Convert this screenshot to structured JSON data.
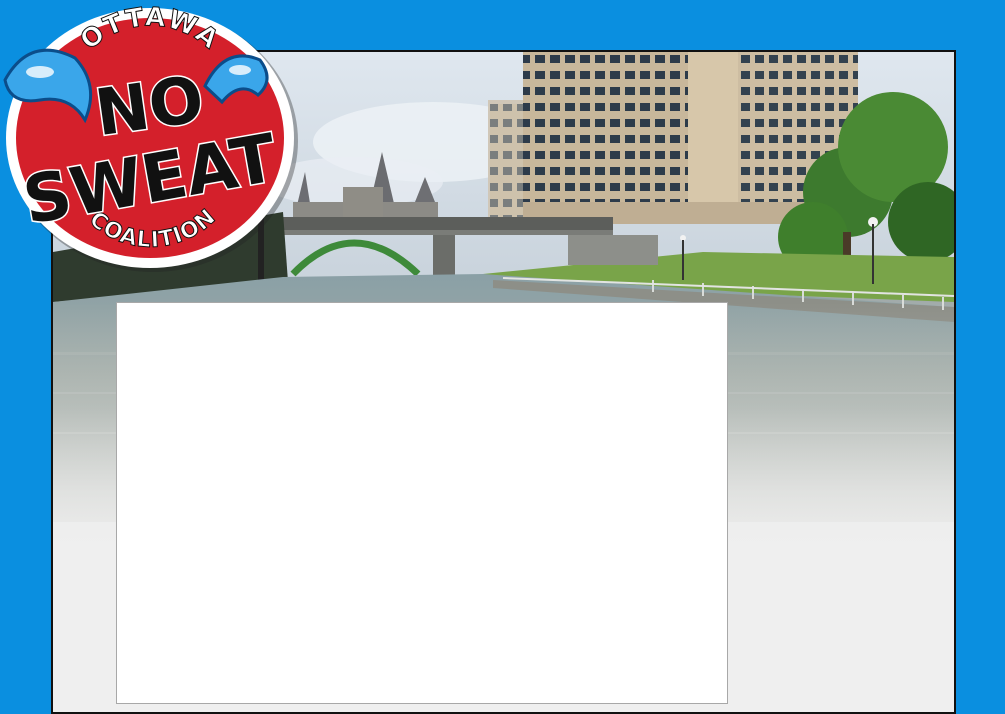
{
  "logo": {
    "top_text": "OTTAWA",
    "main_line1": "NO",
    "main_line2": "SWEAT",
    "bottom_text": "COALITION"
  },
  "colors": {
    "page_background": "#0a8fe0",
    "logo_red": "#d4202b",
    "logo_drop_blue": "#3aa6ea",
    "panel_background": "#ffffff"
  },
  "header_image": {
    "icon": "canal-cityscape-photo"
  }
}
